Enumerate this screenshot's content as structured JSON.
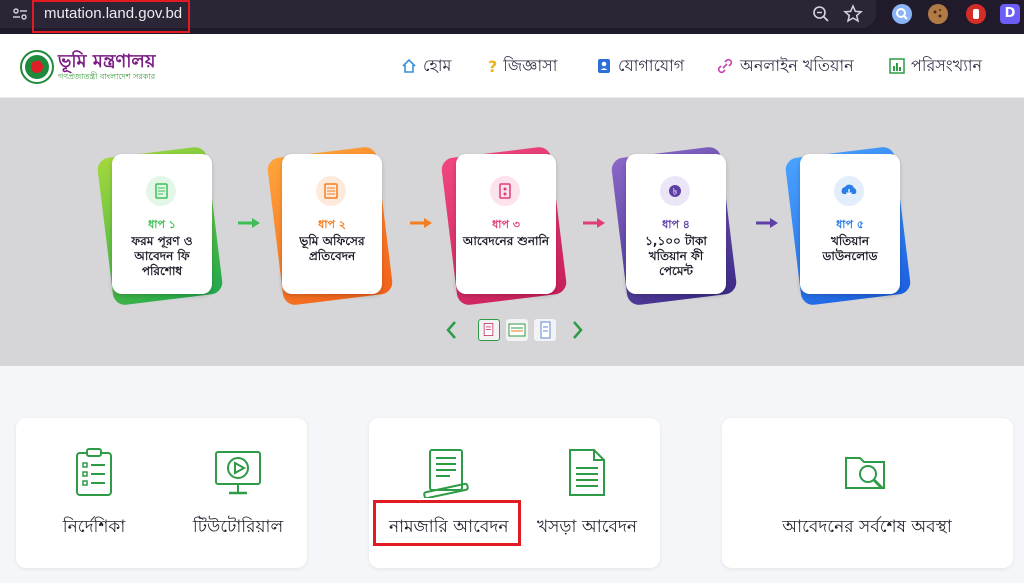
{
  "browser": {
    "url": "mutation.land.gov.bd",
    "extensions": [
      {
        "name": "magnifier-extension-icon",
        "color": "#8ab4f8"
      },
      {
        "name": "cookie-extension-icon",
        "color": "#b27b45"
      },
      {
        "name": "stop-hand-extension-icon",
        "color": "#d42c26"
      },
      {
        "name": "d-extension-icon",
        "color": "#6b5df5",
        "letter": "D"
      }
    ]
  },
  "header": {
    "brand_title": "ভূমি মন্ত্রণালয়",
    "brand_sub": "গণপ্রজাতন্ত্রী বাংলাদেশ সরকার",
    "nav": [
      {
        "label": "হোম",
        "icon": "home-icon"
      },
      {
        "label": "জিজ্ঞাসা",
        "icon": "question-icon"
      },
      {
        "label": "যোগাযোগ",
        "icon": "contact-icon"
      },
      {
        "label": "অনলাইন খতিয়ান",
        "icon": "link-icon"
      },
      {
        "label": "পরিসংখ্যান",
        "icon": "statistics-icon"
      }
    ]
  },
  "steps": [
    {
      "num": "ধাপ ১",
      "title": "ফরম পূরণ ও আবেদন ফি পরিশোধ",
      "color": "#3dbf55",
      "icon": "form-icon"
    },
    {
      "num": "ধাপ ২",
      "title": "ভূমি অফিসের প্রতিবেদন",
      "color": "#f57c1f",
      "icon": "report-icon"
    },
    {
      "num": "ধাপ ৩",
      "title": "আবেদনের শুনানি",
      "color": "#e23b7a",
      "icon": "hearing-icon"
    },
    {
      "num": "ধাপ ৪",
      "title": "১,১০০ টাকা খতিয়ান ফী পেমেন্ট",
      "color": "#5e3fa5",
      "icon": "payment-icon"
    },
    {
      "num": "ধাপ ৫",
      "title": "খতিয়ান ডাউনলোড",
      "color": "#2b7de8",
      "icon": "download-icon"
    }
  ],
  "cards": {
    "guide_label": "নির্দেশিকা",
    "tutorial_label": "টিউটোরিয়াল",
    "mutation_label": "নামজারি আবেদন",
    "draft_label": "খসড়া আবেদন",
    "status_label": "আবেদনের সর্বশেষ অবস্থা"
  },
  "colors": {
    "accent_green": "#2e9b46",
    "brand_purple": "#7b1c84",
    "highlight_red": "#e21b23"
  }
}
